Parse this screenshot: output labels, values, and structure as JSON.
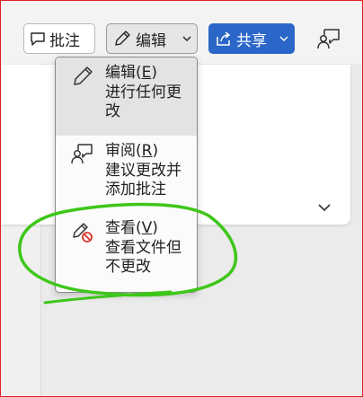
{
  "toolbar": {
    "comment_label": "批注",
    "edit_label": "编辑",
    "share_label": "共享"
  },
  "mode_menu": {
    "items": [
      {
        "title": "编辑(",
        "key": "E",
        "close": ")",
        "desc": "进行任何更改",
        "selected": true
      },
      {
        "title": "审阅(",
        "key": "R",
        "close": ")",
        "desc": "建议更改并添加批注",
        "selected": false
      },
      {
        "title": "查看(",
        "key": "V",
        "close": ")",
        "desc": "查看文件但不更改",
        "selected": false
      }
    ]
  },
  "colors": {
    "share_blue": "#2b66c9",
    "annotation_green": "#3ec61a",
    "frame_red": "#e02020",
    "view_icon_red": "#d9342b"
  }
}
